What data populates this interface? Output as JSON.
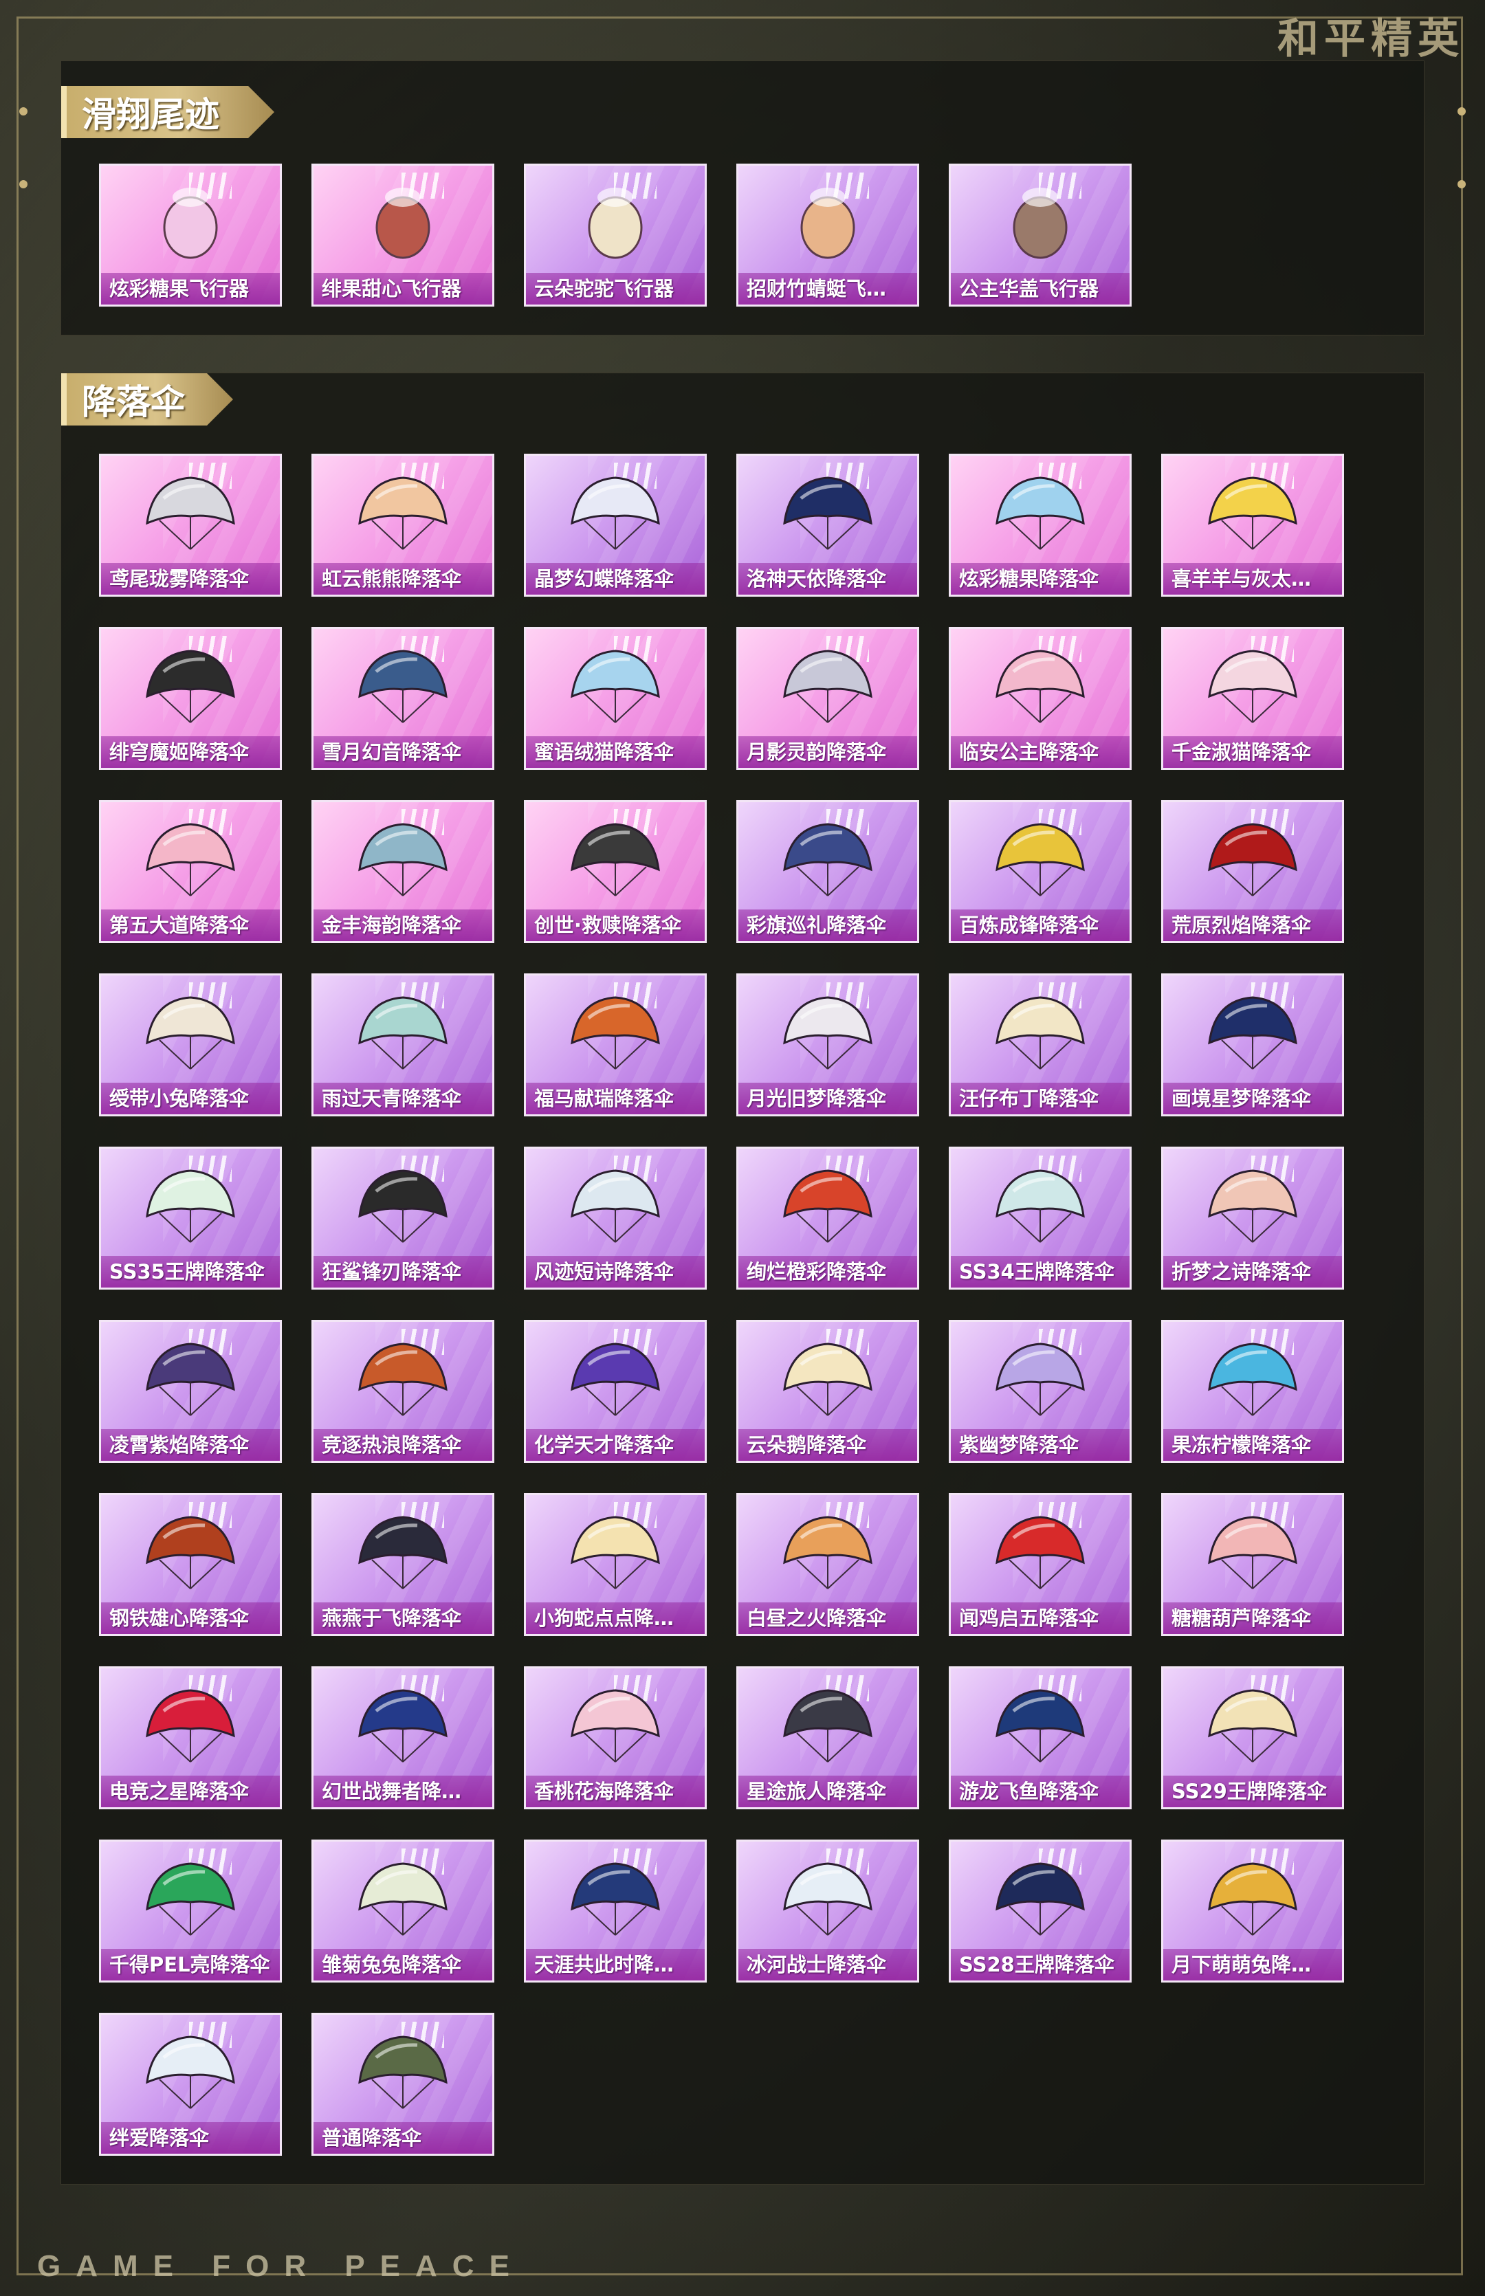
{
  "brand": {
    "top_logo": "和平精英",
    "bottom_logo": "GAME FOR PEACE"
  },
  "sections": [
    {
      "title": "滑翔尾迹",
      "items": [
        {
          "name": "炫彩糖果飞行器",
          "rarity": "pink",
          "icon": "candy-glider-icon",
          "color": "#f2c6e6"
        },
        {
          "name": "绯果甜心飞行器",
          "rarity": "pink",
          "icon": "sweetheart-glider-icon",
          "color": "#b8574a"
        },
        {
          "name": "云朵驼驼飞行器",
          "rarity": "purple",
          "icon": "alpaca-glider-icon",
          "color": "#efe3c8"
        },
        {
          "name": "招财竹蜻蜓飞…",
          "rarity": "purple",
          "icon": "bamboo-copter-glider-icon",
          "color": "#e8b48a"
        },
        {
          "name": "公主华盖飞行器",
          "rarity": "purple",
          "icon": "princess-canopy-glider-icon",
          "color": "#9a7a6a"
        }
      ]
    },
    {
      "title": "降落伞",
      "items": [
        {
          "name": "鸢尾珑雾降落伞",
          "rarity": "pink",
          "icon": "parachute-icon",
          "color": "#d8d8de"
        },
        {
          "name": "虹云熊熊降落伞",
          "rarity": "pink",
          "icon": "parachute-icon",
          "color": "#f1c6a0"
        },
        {
          "name": "晶梦幻蝶降落伞",
          "rarity": "purple",
          "icon": "parachute-icon",
          "color": "#e7e9f6"
        },
        {
          "name": "洛神天依降落伞",
          "rarity": "purple",
          "icon": "parachute-icon",
          "color": "#1f2e66"
        },
        {
          "name": "炫彩糖果降落伞",
          "rarity": "pink",
          "icon": "parachute-icon",
          "color": "#9fd2ee"
        },
        {
          "name": "喜羊羊与灰太…",
          "rarity": "pink",
          "icon": "parachute-icon",
          "color": "#f3d24a"
        },
        {
          "name": "绯穹魔姬降落伞",
          "rarity": "pink",
          "icon": "parachute-icon",
          "color": "#2c2c2c"
        },
        {
          "name": "雪月幻音降落伞",
          "rarity": "pink",
          "icon": "parachute-icon",
          "color": "#3a5c8c"
        },
        {
          "name": "蜜语绒猫降落伞",
          "rarity": "pink",
          "icon": "parachute-icon",
          "color": "#a7d4ee"
        },
        {
          "name": "月影灵韵降落伞",
          "rarity": "pink",
          "icon": "parachute-icon",
          "color": "#c8c8d8"
        },
        {
          "name": "临安公主降落伞",
          "rarity": "pink",
          "icon": "parachute-icon",
          "color": "#f3b8cc"
        },
        {
          "name": "千金淑猫降落伞",
          "rarity": "pink",
          "icon": "parachute-icon",
          "color": "#f4d6e0"
        },
        {
          "name": "第五大道降落伞",
          "rarity": "pink",
          "icon": "parachute-icon",
          "color": "#f4b6c8"
        },
        {
          "name": "金丰海韵降落伞",
          "rarity": "pink",
          "icon": "parachute-icon",
          "color": "#8fb6c8"
        },
        {
          "name": "创世·救赎降落伞",
          "rarity": "pink",
          "icon": "parachute-icon",
          "color": "#3a3a3a"
        },
        {
          "name": "彩旗巡礼降落伞",
          "rarity": "purple",
          "icon": "parachute-icon",
          "color": "#3a4a8a"
        },
        {
          "name": "百炼成锋降落伞",
          "rarity": "purple",
          "icon": "parachute-icon",
          "color": "#e8c43a"
        },
        {
          "name": "荒原烈焰降落伞",
          "rarity": "purple",
          "icon": "parachute-icon",
          "color": "#b01a1a"
        },
        {
          "name": "绶带小兔降落伞",
          "rarity": "purple",
          "icon": "parachute-icon",
          "color": "#efe6d6"
        },
        {
          "name": "雨过天青降落伞",
          "rarity": "purple",
          "icon": "parachute-icon",
          "color": "#a9d6d0"
        },
        {
          "name": "福马献瑞降落伞",
          "rarity": "purple",
          "icon": "parachute-icon",
          "color": "#d8662a"
        },
        {
          "name": "月光旧梦降落伞",
          "rarity": "purple",
          "icon": "parachute-icon",
          "color": "#ece8ee"
        },
        {
          "name": "汪仔布丁降落伞",
          "rarity": "purple",
          "icon": "parachute-icon",
          "color": "#f2e6c6"
        },
        {
          "name": "画境星梦降落伞",
          "rarity": "purple",
          "icon": "parachute-icon",
          "color": "#1f2f6a"
        },
        {
          "name": "SS35王牌降落伞",
          "rarity": "purple",
          "icon": "parachute-icon",
          "color": "#dff2e2"
        },
        {
          "name": "狂鲨锋刃降落伞",
          "rarity": "purple",
          "icon": "parachute-icon",
          "color": "#2a2a2a"
        },
        {
          "name": "风迹短诗降落伞",
          "rarity": "purple",
          "icon": "parachute-icon",
          "color": "#dde8f0"
        },
        {
          "name": "绚烂橙彩降落伞",
          "rarity": "purple",
          "icon": "parachute-icon",
          "color": "#d8442a"
        },
        {
          "name": "SS34王牌降落伞",
          "rarity": "purple",
          "icon": "parachute-icon",
          "color": "#cfe8e8"
        },
        {
          "name": "折梦之诗降落伞",
          "rarity": "purple",
          "icon": "parachute-icon",
          "color": "#f0c6b6"
        },
        {
          "name": "凌霄紫焰降落伞",
          "rarity": "purple",
          "icon": "parachute-icon",
          "color": "#4a3a7a"
        },
        {
          "name": "竞逐热浪降落伞",
          "rarity": "purple",
          "icon": "parachute-icon",
          "color": "#c85a2a"
        },
        {
          "name": "化学天才降落伞",
          "rarity": "purple",
          "icon": "parachute-icon",
          "color": "#5a3ab0"
        },
        {
          "name": "云朵鹅降落伞",
          "rarity": "purple",
          "icon": "parachute-icon",
          "color": "#f4e6c0"
        },
        {
          "name": "紫幽梦降落伞",
          "rarity": "purple",
          "icon": "parachute-icon",
          "color": "#b8a6e6"
        },
        {
          "name": "果冻柠檬降落伞",
          "rarity": "purple",
          "icon": "parachute-icon",
          "color": "#4ab6e0"
        },
        {
          "name": "钢铁雄心降落伞",
          "rarity": "purple",
          "icon": "parachute-icon",
          "color": "#b0401e"
        },
        {
          "name": "燕燕于飞降落伞",
          "rarity": "purple",
          "icon": "parachute-icon",
          "color": "#2a2a3a"
        },
        {
          "name": "小狗蛇点点降…",
          "rarity": "purple",
          "icon": "parachute-icon",
          "color": "#f4e2b0"
        },
        {
          "name": "白昼之火降落伞",
          "rarity": "purple",
          "icon": "parachute-icon",
          "color": "#e8a05a"
        },
        {
          "name": "闻鸡启五降落伞",
          "rarity": "purple",
          "icon": "parachute-icon",
          "color": "#d82a2a"
        },
        {
          "name": "糖糖葫芦降落伞",
          "rarity": "purple",
          "icon": "parachute-icon",
          "color": "#f2b6b6"
        },
        {
          "name": "电竞之星降落伞",
          "rarity": "purple",
          "icon": "parachute-icon",
          "color": "#d81e3a"
        },
        {
          "name": "幻世战舞者降…",
          "rarity": "purple",
          "icon": "parachute-icon",
          "color": "#243a8a"
        },
        {
          "name": "香桃花海降落伞",
          "rarity": "purple",
          "icon": "parachute-icon",
          "color": "#f4c6d4"
        },
        {
          "name": "星途旅人降落伞",
          "rarity": "purple",
          "icon": "parachute-icon",
          "color": "#3a3a46"
        },
        {
          "name": "游龙飞鱼降落伞",
          "rarity": "purple",
          "icon": "parachute-icon",
          "color": "#1e3a7a"
        },
        {
          "name": "SS29王牌降落伞",
          "rarity": "purple",
          "icon": "parachute-icon",
          "color": "#f2e2b6"
        },
        {
          "name": "千得PEL亮降落伞",
          "rarity": "purple",
          "icon": "parachute-icon",
          "color": "#2aa65a"
        },
        {
          "name": "雏菊兔兔降落伞",
          "rarity": "purple",
          "icon": "parachute-icon",
          "color": "#e6ecd6"
        },
        {
          "name": "天涯共此时降…",
          "rarity": "purple",
          "icon": "parachute-icon",
          "color": "#243a7a"
        },
        {
          "name": "冰河战士降落伞",
          "rarity": "purple",
          "icon": "parachute-icon",
          "color": "#e6eef6"
        },
        {
          "name": "SS28王牌降落伞",
          "rarity": "purple",
          "icon": "parachute-icon",
          "color": "#1e2a5a"
        },
        {
          "name": "月下萌萌兔降…",
          "rarity": "purple",
          "icon": "parachute-icon",
          "color": "#e6b03a"
        },
        {
          "name": "绊爱降落伞",
          "rarity": "purple",
          "icon": "parachute-icon",
          "color": "#e6eef6"
        },
        {
          "name": "普通降落伞",
          "rarity": "purple",
          "icon": "parachute-icon",
          "color": "#5a6a46"
        }
      ]
    }
  ]
}
